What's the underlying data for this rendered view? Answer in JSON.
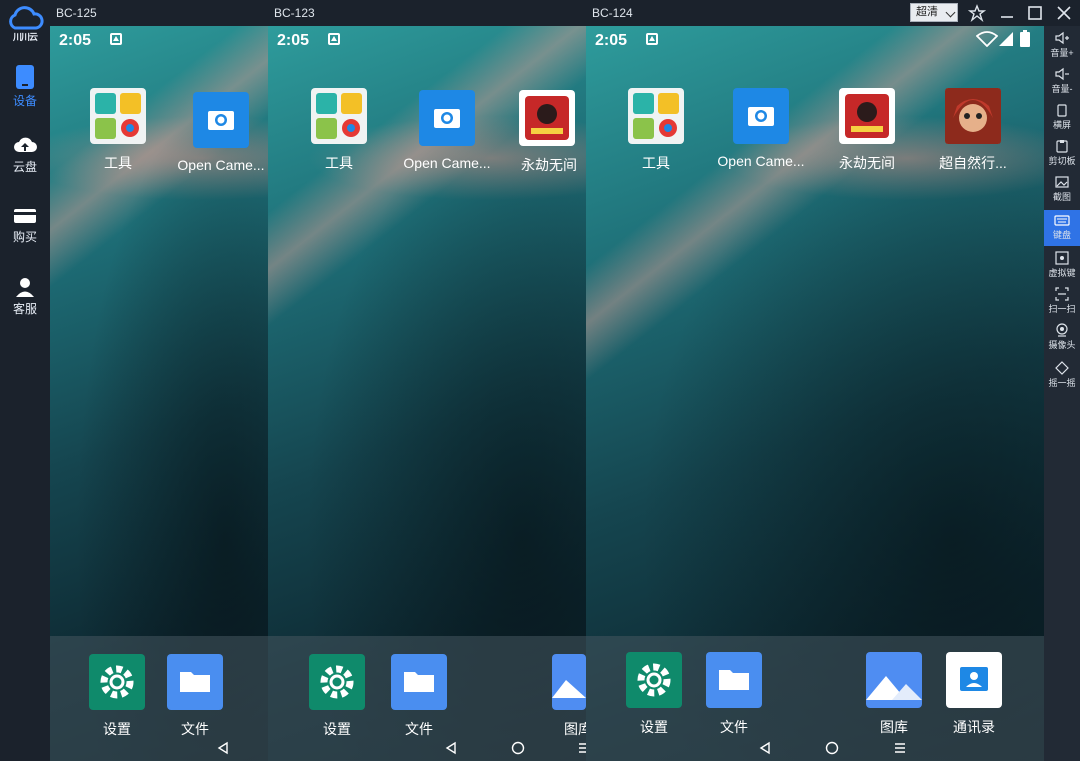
{
  "sidebar": {
    "logo_text": "川川云",
    "items": [
      {
        "label": "设备",
        "icon": "phone-icon",
        "active": true
      },
      {
        "label": "云盘",
        "icon": "cloud-upload-icon",
        "active": false
      },
      {
        "label": "购买",
        "icon": "card-icon",
        "active": false
      },
      {
        "label": "客服",
        "icon": "headset-icon",
        "active": false
      }
    ]
  },
  "windows": [
    {
      "title": "BC-125"
    },
    {
      "title": "BC-123"
    },
    {
      "title": "BC-124"
    }
  ],
  "window_controls": {
    "quality": "超清",
    "pin": "pin-icon",
    "minimize": "minimize-icon",
    "maximize": "maximize-icon",
    "close": "close-icon"
  },
  "toolbar": [
    {
      "label": "音量+",
      "icon": "volume-up-icon"
    },
    {
      "label": "音量-",
      "icon": "volume-down-icon"
    },
    {
      "label": "横屏",
      "icon": "rotate-icon"
    },
    {
      "label": "剪切板",
      "icon": "clipboard-icon"
    },
    {
      "label": "截图",
      "icon": "screenshot-icon"
    },
    {
      "label": "键盘",
      "icon": "keyboard-icon",
      "active": true
    },
    {
      "label": "虚拟键",
      "icon": "virtual-key-icon"
    },
    {
      "label": "扫一扫",
      "icon": "scan-icon"
    },
    {
      "label": "摄像头",
      "icon": "camera-icon"
    },
    {
      "label": "摇一摇",
      "icon": "shake-icon"
    }
  ],
  "phone": {
    "time": "2:05",
    "apps": {
      "tools": "工具",
      "camera": "Open Came...",
      "game1": "永劫无间",
      "game2": "超自然行...",
      "settings": "设置",
      "files": "文件",
      "gallery": "图库",
      "contacts": "通讯录"
    },
    "phone2_gallery_partial": "图库"
  },
  "colors": {
    "accent": "#2f73e6",
    "sidebar_bg": "#1b222c"
  }
}
